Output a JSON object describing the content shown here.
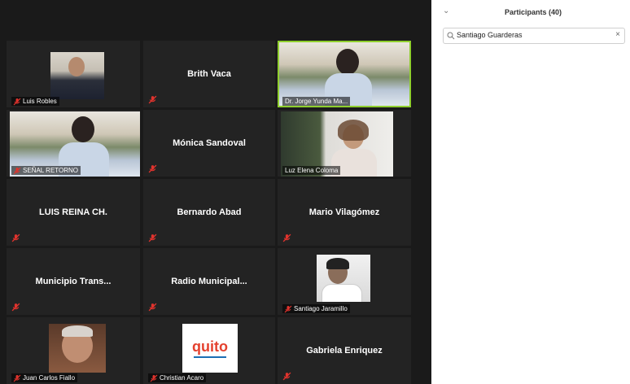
{
  "gallery": {
    "tiles": [
      {
        "name": "Luis Robles"
      },
      {
        "name": "Brith Vaca"
      },
      {
        "name": "Dr. Jorge Yunda Ma..."
      },
      {
        "name": "SEÑAL RETORNO"
      },
      {
        "name": "Mónica Sandoval"
      },
      {
        "name": "Luz Elena Coloma"
      },
      {
        "name": "LUIS REINA CH."
      },
      {
        "name": "Bernardo Abad"
      },
      {
        "name": "Mario Vilagómez"
      },
      {
        "name": "Municipio  Trans..."
      },
      {
        "name": "Radio  Municipal..."
      },
      {
        "name": "Santiago Jaramillo"
      },
      {
        "name": "Juan Carlos Fiallo"
      },
      {
        "name": "Christian Acaro"
      },
      {
        "name": "Gabriela Enriquez"
      }
    ],
    "logo_text": "quito"
  },
  "participants": {
    "title": "Participants (40)",
    "search_value": "Santiago Guarderas",
    "clear_glyph": "×",
    "collapse_glyph": "⌄"
  },
  "colors": {
    "gallery_bg": "#1a1a1a",
    "tile_bg": "#232323",
    "active_speaker": "#8fcf2e",
    "mic_muted": "#e0332d"
  }
}
